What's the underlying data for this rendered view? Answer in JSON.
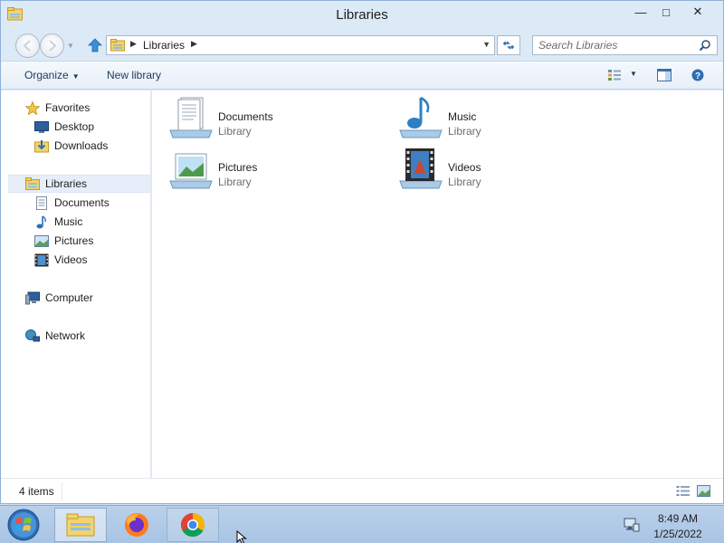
{
  "window": {
    "title": "Libraries",
    "minimize_glyph": "—",
    "maximize_glyph": "□",
    "close_glyph": "✕"
  },
  "navigation": {
    "address_path": "Libraries",
    "search_placeholder": "Search Libraries"
  },
  "toolbar": {
    "organize_label": "Organize",
    "new_library_label": "New library"
  },
  "sidebar": {
    "favorites": {
      "label": "Favorites",
      "icon": "star-icon"
    },
    "favorites_items": [
      {
        "label": "Desktop",
        "icon": "desktop-icon"
      },
      {
        "label": "Downloads",
        "icon": "downloads-icon"
      }
    ],
    "libraries": {
      "label": "Libraries",
      "icon": "libraries-icon"
    },
    "libraries_items": [
      {
        "label": "Documents",
        "icon": "documents-icon"
      },
      {
        "label": "Music",
        "icon": "music-icon"
      },
      {
        "label": "Pictures",
        "icon": "pictures-icon"
      },
      {
        "label": "Videos",
        "icon": "videos-icon"
      }
    ],
    "computer": {
      "label": "Computer",
      "icon": "computer-icon"
    },
    "network": {
      "label": "Network",
      "icon": "network-icon"
    }
  },
  "libraries": [
    {
      "name": "Documents",
      "type": "Library",
      "icon": "documents-library-icon"
    },
    {
      "name": "Music",
      "type": "Library",
      "icon": "music-library-icon"
    },
    {
      "name": "Pictures",
      "type": "Library",
      "icon": "pictures-library-icon"
    },
    {
      "name": "Videos",
      "type": "Library",
      "icon": "videos-library-icon"
    }
  ],
  "status": {
    "item_count": "4 items"
  },
  "taskbar": {
    "apps": [
      {
        "name": "file-explorer",
        "icon": "folder-icon",
        "state": "active"
      },
      {
        "name": "firefox",
        "icon": "firefox-icon",
        "state": "pinned"
      },
      {
        "name": "chrome",
        "icon": "chrome-icon",
        "state": "open"
      }
    ],
    "clock_time": "8:49 AM",
    "clock_date": "1/25/2022"
  },
  "colors": {
    "window_frame": "#dce9f7",
    "taskbar": "#b9d0ea",
    "selected_row": "#e5eef9",
    "link_blue": "#2d6fb4"
  }
}
